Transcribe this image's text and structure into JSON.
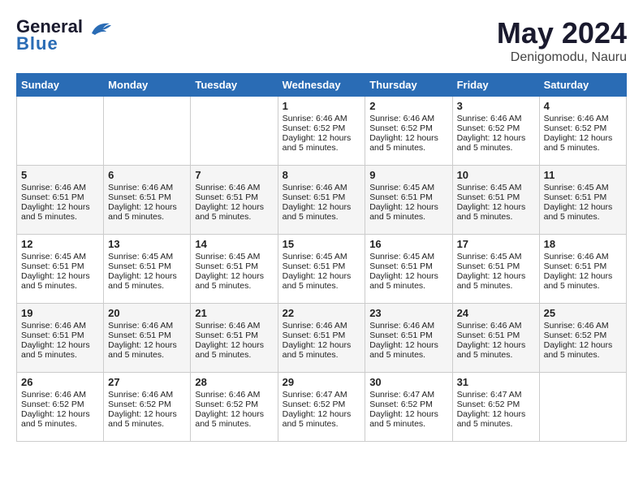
{
  "header": {
    "logo_line1": "General",
    "logo_line2": "Blue",
    "month": "May 2024",
    "location": "Denigomodu, Nauru"
  },
  "weekdays": [
    "Sunday",
    "Monday",
    "Tuesday",
    "Wednesday",
    "Thursday",
    "Friday",
    "Saturday"
  ],
  "weeks": [
    [
      {
        "day": "",
        "info": ""
      },
      {
        "day": "",
        "info": ""
      },
      {
        "day": "",
        "info": ""
      },
      {
        "day": "1",
        "info": "Sunrise: 6:46 AM\nSunset: 6:52 PM\nDaylight: 12 hours\nand 5 minutes."
      },
      {
        "day": "2",
        "info": "Sunrise: 6:46 AM\nSunset: 6:52 PM\nDaylight: 12 hours\nand 5 minutes."
      },
      {
        "day": "3",
        "info": "Sunrise: 6:46 AM\nSunset: 6:52 PM\nDaylight: 12 hours\nand 5 minutes."
      },
      {
        "day": "4",
        "info": "Sunrise: 6:46 AM\nSunset: 6:52 PM\nDaylight: 12 hours\nand 5 minutes."
      }
    ],
    [
      {
        "day": "5",
        "info": "Sunrise: 6:46 AM\nSunset: 6:51 PM\nDaylight: 12 hours\nand 5 minutes."
      },
      {
        "day": "6",
        "info": "Sunrise: 6:46 AM\nSunset: 6:51 PM\nDaylight: 12 hours\nand 5 minutes."
      },
      {
        "day": "7",
        "info": "Sunrise: 6:46 AM\nSunset: 6:51 PM\nDaylight: 12 hours\nand 5 minutes."
      },
      {
        "day": "8",
        "info": "Sunrise: 6:46 AM\nSunset: 6:51 PM\nDaylight: 12 hours\nand 5 minutes."
      },
      {
        "day": "9",
        "info": "Sunrise: 6:45 AM\nSunset: 6:51 PM\nDaylight: 12 hours\nand 5 minutes."
      },
      {
        "day": "10",
        "info": "Sunrise: 6:45 AM\nSunset: 6:51 PM\nDaylight: 12 hours\nand 5 minutes."
      },
      {
        "day": "11",
        "info": "Sunrise: 6:45 AM\nSunset: 6:51 PM\nDaylight: 12 hours\nand 5 minutes."
      }
    ],
    [
      {
        "day": "12",
        "info": "Sunrise: 6:45 AM\nSunset: 6:51 PM\nDaylight: 12 hours\nand 5 minutes."
      },
      {
        "day": "13",
        "info": "Sunrise: 6:45 AM\nSunset: 6:51 PM\nDaylight: 12 hours\nand 5 minutes."
      },
      {
        "day": "14",
        "info": "Sunrise: 6:45 AM\nSunset: 6:51 PM\nDaylight: 12 hours\nand 5 minutes."
      },
      {
        "day": "15",
        "info": "Sunrise: 6:45 AM\nSunset: 6:51 PM\nDaylight: 12 hours\nand 5 minutes."
      },
      {
        "day": "16",
        "info": "Sunrise: 6:45 AM\nSunset: 6:51 PM\nDaylight: 12 hours\nand 5 minutes."
      },
      {
        "day": "17",
        "info": "Sunrise: 6:45 AM\nSunset: 6:51 PM\nDaylight: 12 hours\nand 5 minutes."
      },
      {
        "day": "18",
        "info": "Sunrise: 6:46 AM\nSunset: 6:51 PM\nDaylight: 12 hours\nand 5 minutes."
      }
    ],
    [
      {
        "day": "19",
        "info": "Sunrise: 6:46 AM\nSunset: 6:51 PM\nDaylight: 12 hours\nand 5 minutes."
      },
      {
        "day": "20",
        "info": "Sunrise: 6:46 AM\nSunset: 6:51 PM\nDaylight: 12 hours\nand 5 minutes."
      },
      {
        "day": "21",
        "info": "Sunrise: 6:46 AM\nSunset: 6:51 PM\nDaylight: 12 hours\nand 5 minutes."
      },
      {
        "day": "22",
        "info": "Sunrise: 6:46 AM\nSunset: 6:51 PM\nDaylight: 12 hours\nand 5 minutes."
      },
      {
        "day": "23",
        "info": "Sunrise: 6:46 AM\nSunset: 6:51 PM\nDaylight: 12 hours\nand 5 minutes."
      },
      {
        "day": "24",
        "info": "Sunrise: 6:46 AM\nSunset: 6:51 PM\nDaylight: 12 hours\nand 5 minutes."
      },
      {
        "day": "25",
        "info": "Sunrise: 6:46 AM\nSunset: 6:52 PM\nDaylight: 12 hours\nand 5 minutes."
      }
    ],
    [
      {
        "day": "26",
        "info": "Sunrise: 6:46 AM\nSunset: 6:52 PM\nDaylight: 12 hours\nand 5 minutes."
      },
      {
        "day": "27",
        "info": "Sunrise: 6:46 AM\nSunset: 6:52 PM\nDaylight: 12 hours\nand 5 minutes."
      },
      {
        "day": "28",
        "info": "Sunrise: 6:46 AM\nSunset: 6:52 PM\nDaylight: 12 hours\nand 5 minutes."
      },
      {
        "day": "29",
        "info": "Sunrise: 6:47 AM\nSunset: 6:52 PM\nDaylight: 12 hours\nand 5 minutes."
      },
      {
        "day": "30",
        "info": "Sunrise: 6:47 AM\nSunset: 6:52 PM\nDaylight: 12 hours\nand 5 minutes."
      },
      {
        "day": "31",
        "info": "Sunrise: 6:47 AM\nSunset: 6:52 PM\nDaylight: 12 hours\nand 5 minutes."
      },
      {
        "day": "",
        "info": ""
      }
    ]
  ]
}
